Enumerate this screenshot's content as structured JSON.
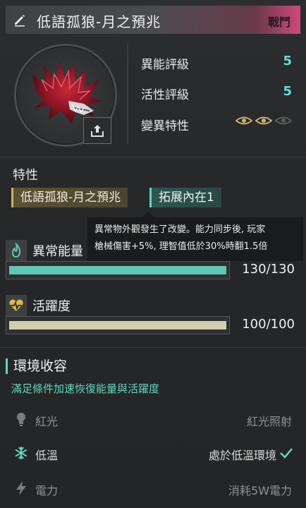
{
  "header": {
    "title": "低語孤狼-月之預兆",
    "badge": "戰鬥",
    "edit_icon": "pencil-icon"
  },
  "stats": [
    {
      "label": "異能評級",
      "value": "5"
    },
    {
      "label": "活性評級",
      "value": "5"
    },
    {
      "label": "變異特性",
      "eyes_active": 2,
      "eyes_total": 3
    }
  ],
  "traits": {
    "title": "特性",
    "items": [
      "低語孤狼-月之預兆",
      "拓展內在1"
    ]
  },
  "tooltip": {
    "line1": "異常物外觀發生了改變。能力同步後, 玩家",
    "line2": "槍械傷害+5%, 理智值低於30%時翻1.5倍"
  },
  "energy": {
    "label": "異常能量",
    "value": "130/130",
    "fraction": 1.0,
    "color": "#5ec7b2",
    "icon": "flame-icon"
  },
  "activity": {
    "label": "活躍度",
    "value": "100/100",
    "fraction": 1.0,
    "color": "#d2cfad",
    "icon": "heart-pulse-icon"
  },
  "environment": {
    "title": "環境收容",
    "subtitle": "滿足條件加速恢復能量與活躍度",
    "rows": [
      {
        "name": "紅光",
        "status": "紅光照射",
        "icon": "bulb-icon",
        "active": false
      },
      {
        "name": "低溫",
        "status": "處於低溫環境",
        "icon": "snowflake-icon",
        "active": true
      },
      {
        "name": "電力",
        "status": "消耗5W電力",
        "icon": "lightning-icon",
        "active": false
      }
    ]
  },
  "colors": {
    "accent": "#5fd7c0",
    "gold": "#c8b46a",
    "header_pink": "#d0487a"
  }
}
